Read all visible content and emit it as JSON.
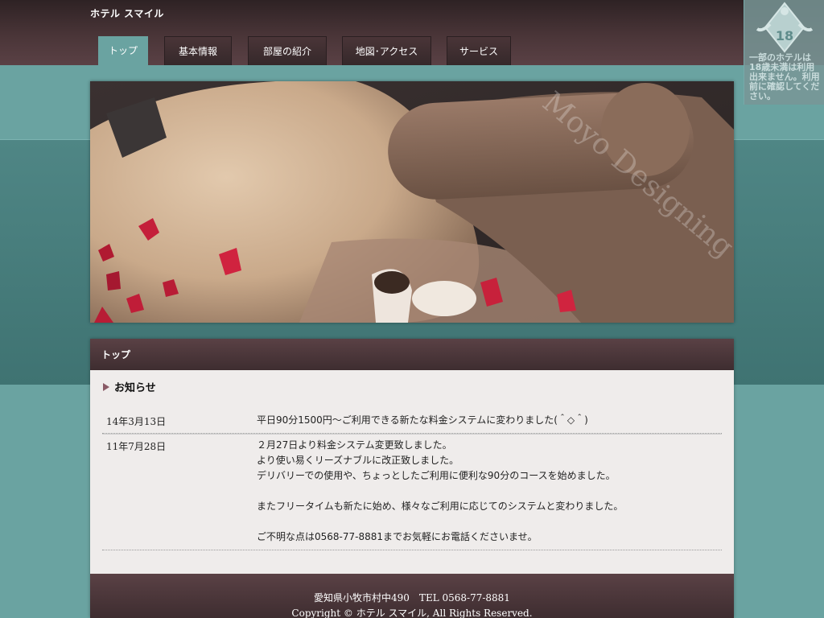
{
  "site": {
    "title": "ホテル スマイル"
  },
  "nav": {
    "tabs": [
      {
        "label": "トップ",
        "active": true
      },
      {
        "label": "基本情報",
        "active": false
      },
      {
        "label": "部屋の紹介",
        "active": false
      },
      {
        "label": "地図･アクセス",
        "active": false
      },
      {
        "label": "サービス",
        "active": false
      }
    ]
  },
  "age_notice": {
    "icon": "age-18-restriction-icon",
    "badge": "18",
    "text": "一部のホテルは18歳未満は利用出来ません。利用前に確認してください。"
  },
  "hero": {
    "watermark": "Moyo Designing"
  },
  "main": {
    "header": "トップ",
    "section_title": "お知らせ",
    "news": [
      {
        "date": "14年3月13日",
        "lines": [
          "平日90分1500円〜ご利用できる新たな料金システムに変わりました(＾◇＾)"
        ]
      },
      {
        "date": "11年7月28日",
        "lines": [
          "２月27日より料金システム変更致しました。",
          "より使い易くリーズナブルに改正致しました。",
          "デリバリーでの使用や、ちょっとしたご利用に便利な90分のコースを始めました。",
          "",
          "またフリータイムも新たに始め、様々なご利用に応じてのシステムと変わりました。",
          "",
          "ご不明な点は0568-77-8881までお気軽にお電話くださいませ。"
        ]
      }
    ]
  },
  "footer": {
    "address": "愛知県小牧市村中490　TEL 0568-77-8881",
    "copyright": "Copyright © ホテル スマイル, All Rights Reserved."
  },
  "colors": {
    "brand_brown": "#4a3538",
    "teal": "#6aa3a1",
    "content_bg": "#efeceb"
  }
}
